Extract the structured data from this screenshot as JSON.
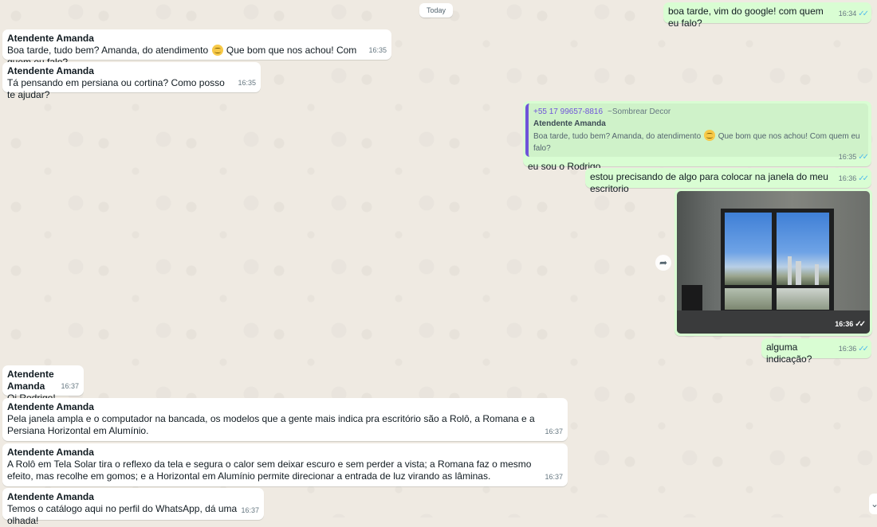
{
  "date_divider": "Today",
  "messages": [
    {
      "text": "boa tarde, vim do google! com quem eu falo?",
      "time": "16:34"
    },
    {
      "sender": "Atendente Amanda",
      "text_a": "Boa tarde, tudo bem? Amanda, do atendimento",
      "text_b": "Que bom que nos achou! Com quem eu falo?",
      "time": "16:35"
    },
    {
      "sender": "Atendente Amanda",
      "text": "Tá pensando em persiana ou cortina? Como posso te ajudar?",
      "time": "16:35"
    },
    {
      "quote": {
        "phone": "+55 17 99657-8816",
        "group": "~Sombrear Decor",
        "name": "Atendente Amanda",
        "text_a": "Boa tarde, tudo bem? Amanda, do atendimento",
        "text_b": "Que bom que nos achou! Com quem eu falo?"
      },
      "text": "eu sou o Rodrigo",
      "time": "16:35"
    },
    {
      "text": "estou precisando de algo para colocar na janela do meu escritorio",
      "time": "16:36"
    },
    {
      "image": "office-window-photo",
      "time": "16:36"
    },
    {
      "text": "alguma indicação?",
      "time": "16:36"
    },
    {
      "sender": "Atendente Amanda",
      "text": "Oi Rodrigo!",
      "time": "16:37"
    },
    {
      "sender": "Atendente Amanda",
      "text": "Pela janela ampla e o computador na bancada, os modelos que a gente mais indica pra escritório são a Rolô, a Romana e a Persiana Horizontal em Alumínio.",
      "time": "16:37"
    },
    {
      "sender": "Atendente Amanda",
      "text": "A Rolô em Tela Solar tira o reflexo da tela e segura o calor sem deixar escuro e sem perder a vista; a Romana faz o mesmo efeito, mas recolhe em gomos; e a Horizontal em Alumínio permite direcionar a entrada de luz virando as lâminas.",
      "time": "16:37"
    },
    {
      "sender": "Atendente Amanda",
      "text": "Temos o catálogo aqui no perfil do WhatsApp, dá uma olhada!",
      "time": "16:37"
    }
  ],
  "icons": {
    "read_receipt": "double-check-icon",
    "forward": "forward-icon",
    "scroll_down": "chevron-down-icon",
    "emoji": "smiling-face-emoji-icon"
  }
}
